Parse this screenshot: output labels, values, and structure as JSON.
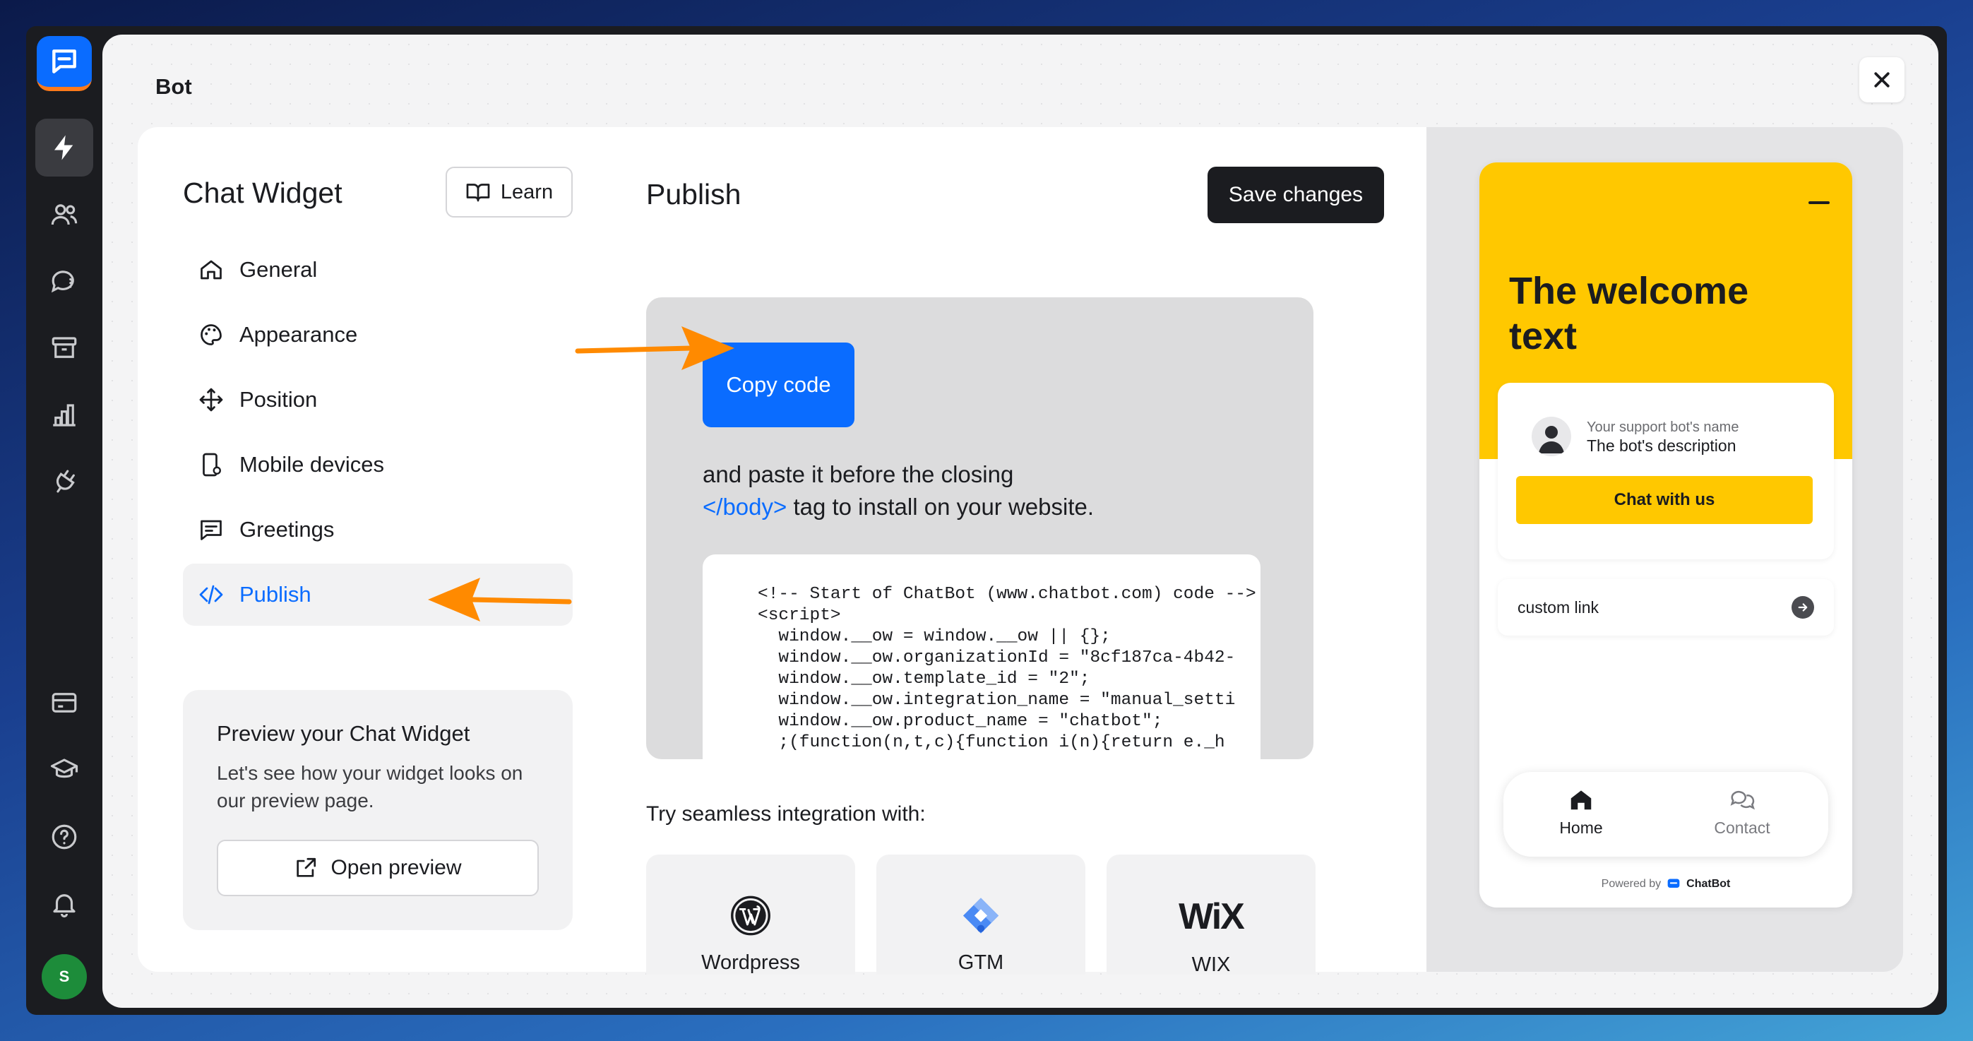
{
  "modal": {
    "title": "Bot",
    "close_icon": "close-icon"
  },
  "sidebar_left": {
    "title": "Chat Widget",
    "learn_label": "Learn",
    "items": [
      {
        "label": "General",
        "icon": "home-icon"
      },
      {
        "label": "Appearance",
        "icon": "palette-icon"
      },
      {
        "label": "Position",
        "icon": "move-icon"
      },
      {
        "label": "Mobile devices",
        "icon": "mobile-icon"
      },
      {
        "label": "Greetings",
        "icon": "message-square-icon"
      },
      {
        "label": "Publish",
        "icon": "code-icon",
        "active": true
      }
    ],
    "preview": {
      "title": "Preview your Chat Widget",
      "text": "Let's see how your widget looks on our preview page.",
      "button_label": "Open preview"
    }
  },
  "publish": {
    "title": "Publish",
    "save_label": "Save changes",
    "copy_label": "Copy code",
    "paste_line1": "and paste it before the closing",
    "paste_tag": "</body>",
    "paste_line2": " tag to install on your website.",
    "code": "<!-- Start of ChatBot (www.chatbot.com) code -->\n<script>\n  window.__ow = window.__ow || {};\n  window.__ow.organizationId = \"8cf187ca-4b42-\n  window.__ow.template_id = \"2\";\n  window.__ow.integration_name = \"manual_setti\n  window.__ow.product_name = \"chatbot\";\n  ;(function(n,t,c){function i(n){return e._h",
    "integration_title": "Try seamless integration with:",
    "integrations": [
      {
        "label": "Wordpress",
        "icon": "wordpress-icon"
      },
      {
        "label": "GTM",
        "icon": "gtm-icon"
      },
      {
        "label": "WIX",
        "icon": "wix-logo"
      }
    ]
  },
  "widget": {
    "welcome": "The welcome text",
    "bot_name": "Your support bot's name",
    "bot_desc": "The bot's description",
    "chat_label": "Chat with us",
    "custom_link": "custom link",
    "nav": [
      {
        "label": "Home"
      },
      {
        "label": "Contact"
      }
    ],
    "powered_label": "Powered by",
    "powered_brand": "ChatBot",
    "accent": "#ffc800"
  },
  "colors": {
    "brand": "#0a6cff",
    "annotation": "#ff8a00",
    "dark": "#1b1c20"
  },
  "user": {
    "initial": "S"
  }
}
